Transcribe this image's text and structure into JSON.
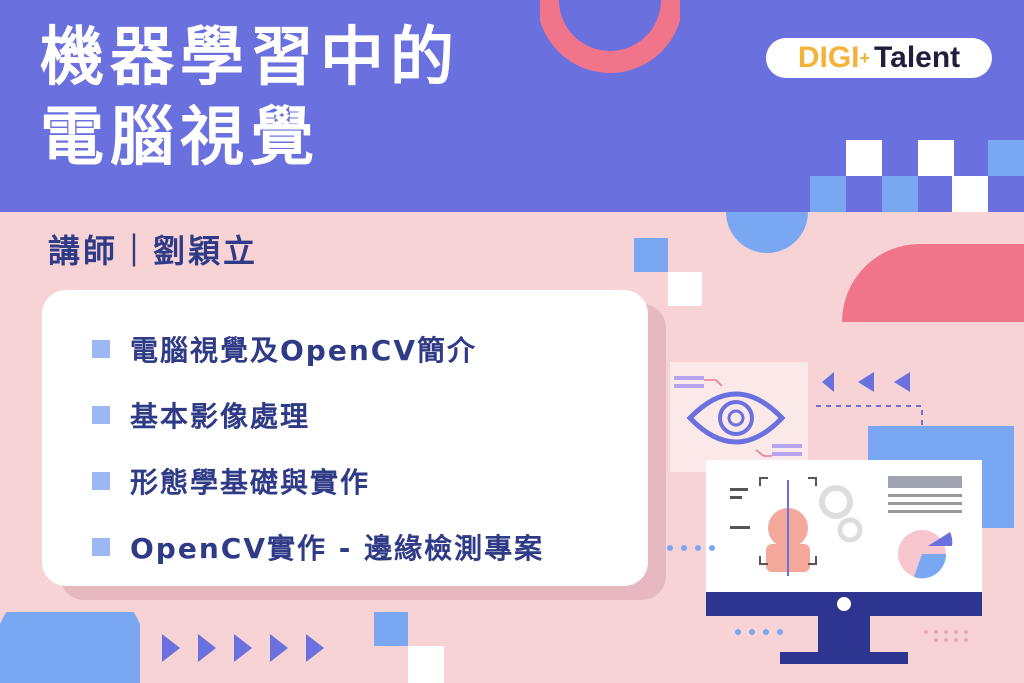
{
  "title_line1": "機器學習中的",
  "title_line2": "電腦視覺",
  "speaker": "講師｜劉穎立",
  "logo": {
    "digi": "DIGI",
    "plus": "+",
    "talent": "Talent"
  },
  "topics": [
    "電腦視覺及OpenCV簡介",
    "基本影像處理",
    "形態學基礎與實作",
    "OpenCV實作 - 邊緣檢測專案"
  ],
  "colors": {
    "band": "#6a70de",
    "background": "#f7d3d6",
    "accent_pink": "#f0758a",
    "accent_blue": "#7aa7f2",
    "text_dark": "#2f3b86"
  }
}
